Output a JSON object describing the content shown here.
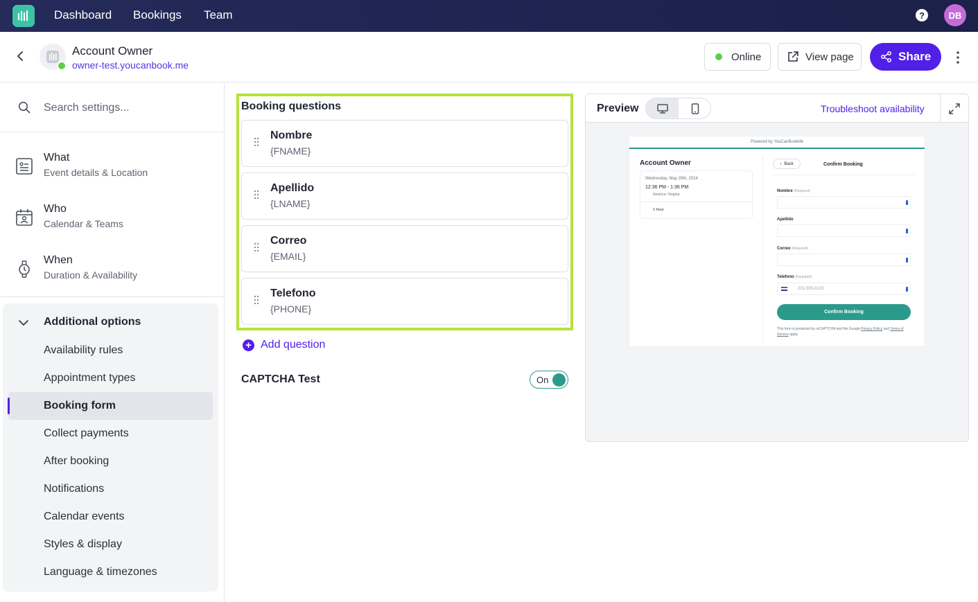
{
  "nav": {
    "links": [
      "Dashboard",
      "Bookings",
      "Team"
    ],
    "help_label": "?",
    "avatar_initials": "DB"
  },
  "header": {
    "account_name": "Account Owner",
    "account_url": "owner-test.youcanbook.me",
    "status_label": "Online",
    "view_page_label": "View page",
    "share_label": "Share"
  },
  "sidebar": {
    "search_placeholder": "Search settings...",
    "main_items": [
      {
        "title": "What",
        "subtitle": "Event details & Location",
        "icon": "document-icon"
      },
      {
        "title": "Who",
        "subtitle": "Calendar & Teams",
        "icon": "calendar-person-icon"
      },
      {
        "title": "When",
        "subtitle": "Duration & Availability",
        "icon": "watch-icon"
      }
    ],
    "additional_title": "Additional options",
    "options": [
      "Availability rules",
      "Appointment types",
      "Booking form",
      "Collect payments",
      "After booking",
      "Notifications",
      "Calendar events",
      "Styles & display",
      "Language & timezones"
    ],
    "active_option": "Booking form"
  },
  "booking_questions": {
    "title": "Booking questions",
    "questions": [
      {
        "name": "Nombre",
        "token": "{FNAME}"
      },
      {
        "name": "Apellido",
        "token": "{LNAME}"
      },
      {
        "name": "Correo",
        "token": "{EMAIL}"
      },
      {
        "name": "Telefono",
        "token": "{PHONE}"
      }
    ],
    "add_label": "Add question",
    "captcha_label": "CAPTCHA Test",
    "captcha_toggle": "On"
  },
  "preview": {
    "title": "Preview",
    "troubleshoot_label": "Troubleshoot availability",
    "mini": {
      "powered_by": "Powered by YouCanBookMe",
      "account_name": "Account Owner",
      "date": "Wednesday, May 29th, 2024",
      "time": "12:36 PM - 1:36 PM",
      "timezone": "America / Regina",
      "duration": "1 hour",
      "back_label": "Back",
      "confirm_title": "Confirm Booking",
      "fields": [
        {
          "label": "Nombre",
          "note": "(Required)"
        },
        {
          "label": "Apellido",
          "note": ""
        },
        {
          "label": "Correo",
          "note": "(Required)"
        },
        {
          "label": "Telefono",
          "note": "(Required)",
          "placeholder": "201-555-0123"
        }
      ],
      "confirm_button": "Confirm Booking",
      "footer_text": "This form is protected by reCAPTCHA and the Google",
      "footer_privacy": "Privacy Policy",
      "footer_and": "and",
      "footer_terms": "Terms of Service",
      "footer_apply": "apply"
    }
  },
  "colors": {
    "accent": "#5020e8",
    "highlight": "#b5e23a",
    "teal": "#2a9b8a",
    "online": "#5ccf4a",
    "nav_bg": "#1e2450"
  }
}
